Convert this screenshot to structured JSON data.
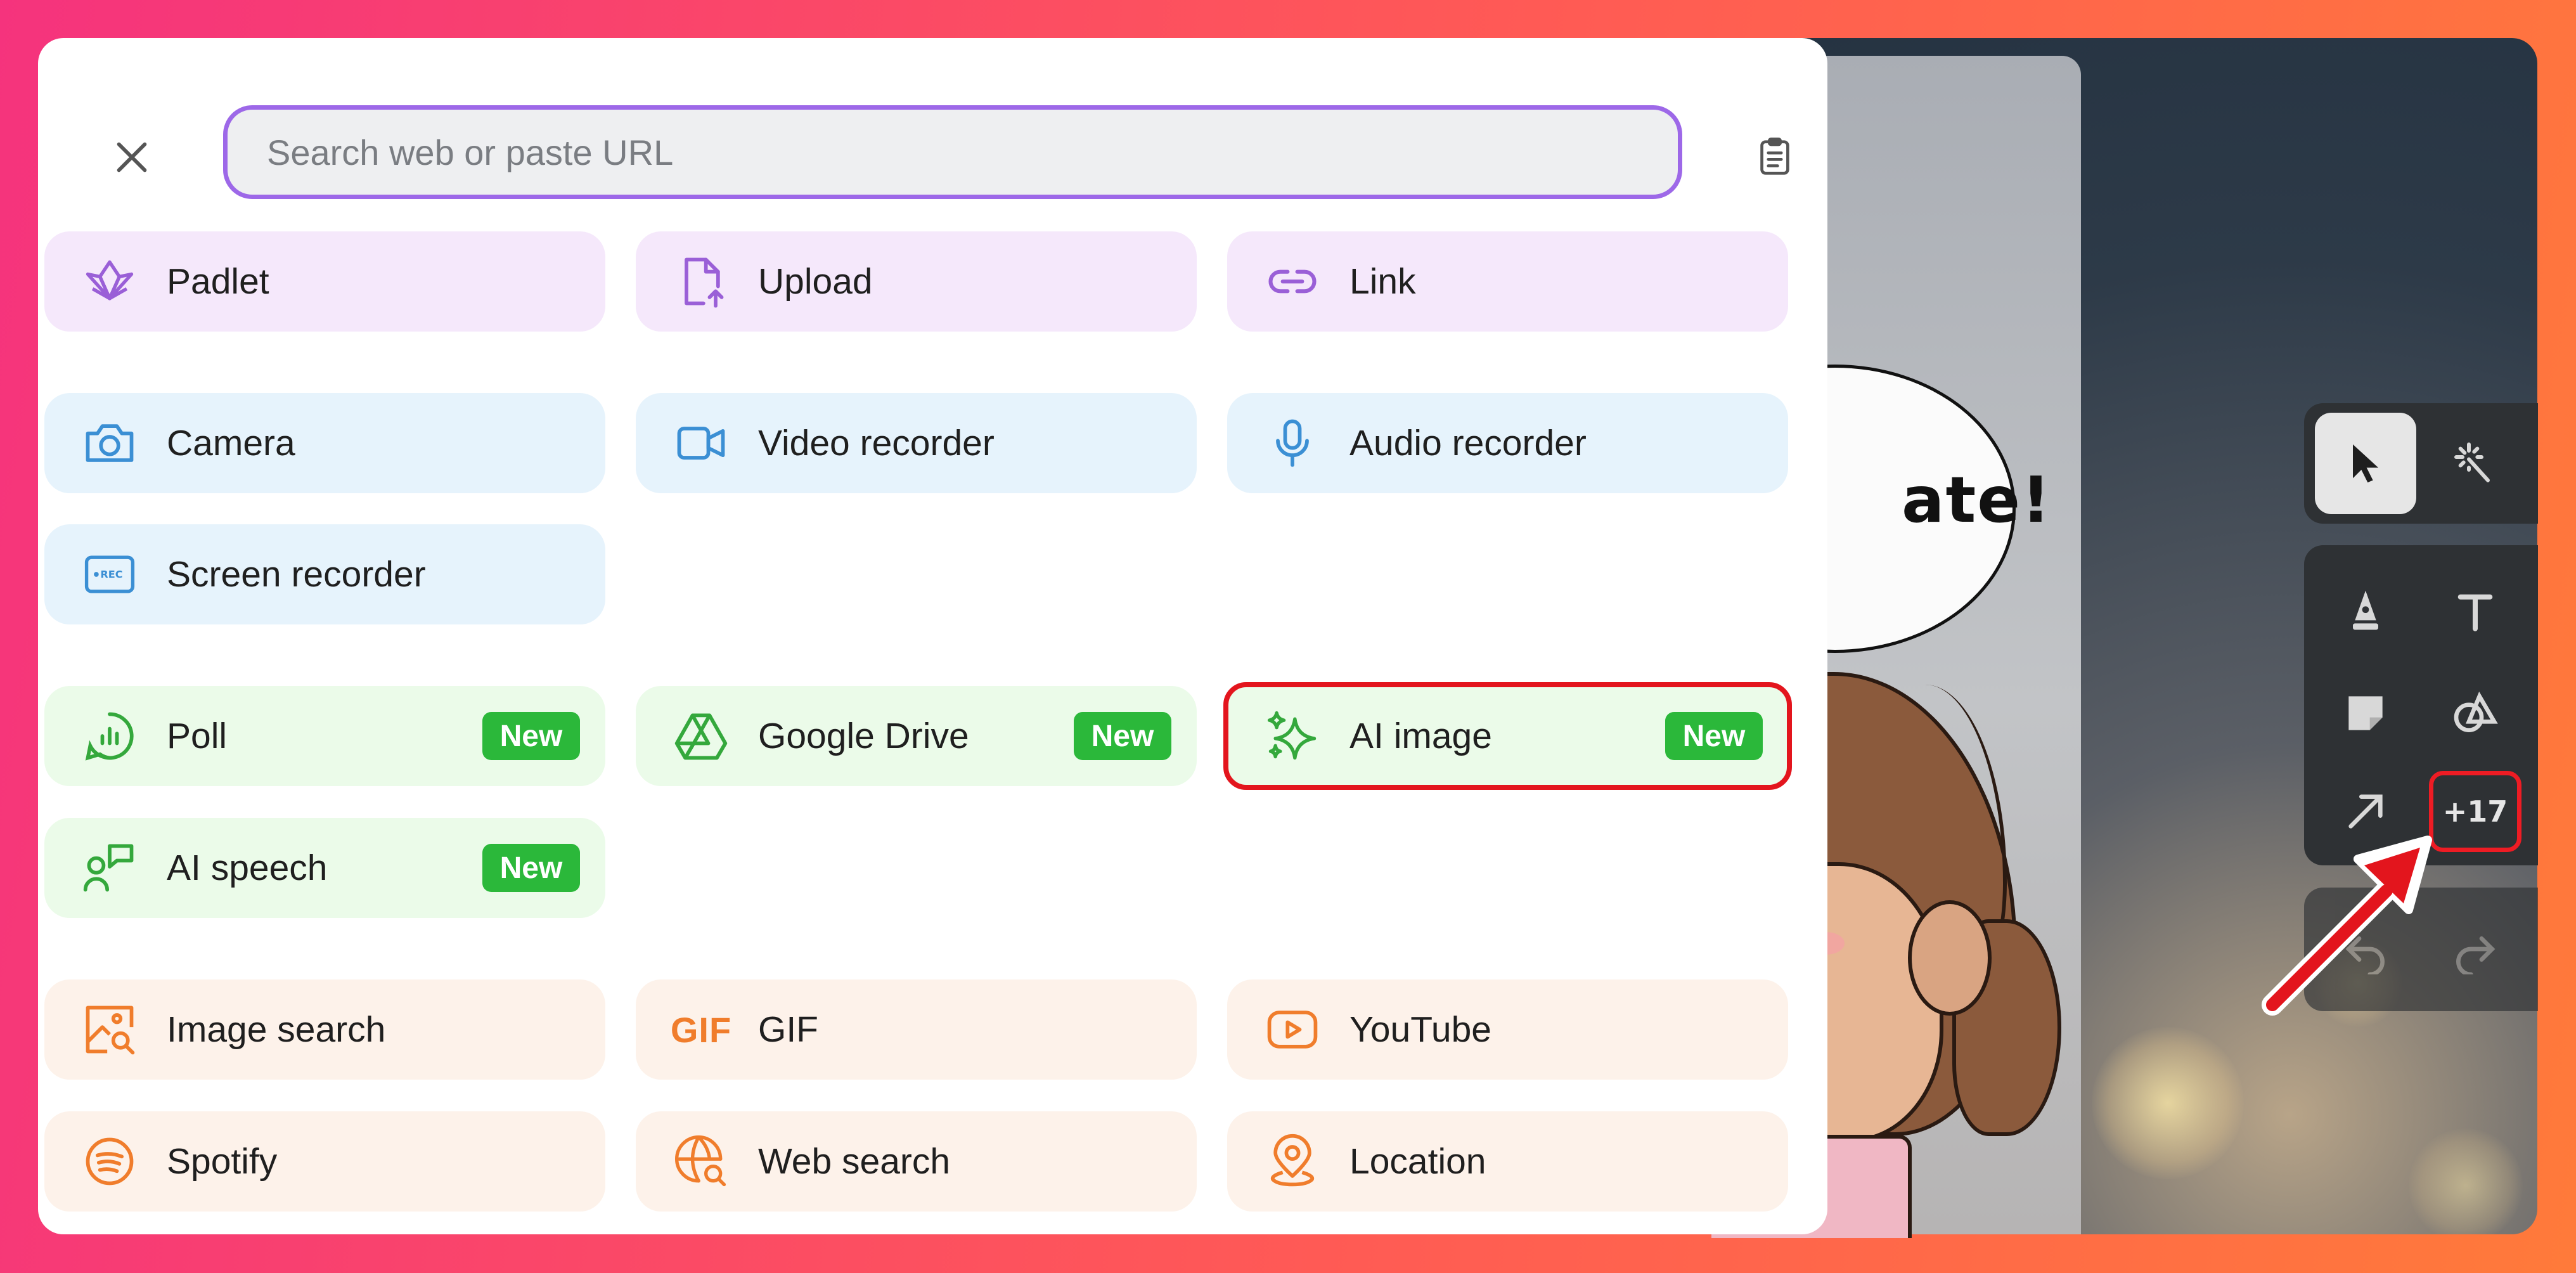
{
  "search": {
    "placeholder": "Search web or paste URL"
  },
  "badge_label": "New",
  "tiles": {
    "padlet": "Padlet",
    "upload": "Upload",
    "link": "Link",
    "camera": "Camera",
    "video_recorder": "Video recorder",
    "audio_recorder": "Audio recorder",
    "screen_recorder": "Screen recorder",
    "poll": "Poll",
    "google_drive": "Google Drive",
    "ai_image": "AI image",
    "ai_speech": "AI speech",
    "image_search": "Image search",
    "gif": "GIF",
    "gif_icon_text": "GIF",
    "youtube": "YouTube",
    "spotify": "Spotify",
    "web_search": "Web search",
    "location": "Location"
  },
  "icons": {
    "close": "close-icon",
    "paste": "clipboard-icon",
    "padlet": "padlet-logo-icon",
    "upload": "file-upload-icon",
    "link": "link-icon",
    "camera": "camera-icon",
    "video_recorder": "video-camera-icon",
    "audio_recorder": "microphone-icon",
    "screen_recorder": "rec-screen-icon",
    "poll": "poll-icon",
    "google_drive": "google-drive-icon",
    "ai_image": "sparkles-icon",
    "ai_speech": "speech-person-icon",
    "image_search": "image-search-icon",
    "youtube": "youtube-icon",
    "spotify": "spotify-icon",
    "web_search": "globe-search-icon",
    "location": "location-pin-icon"
  },
  "toolbar": {
    "more_count": "+17"
  },
  "canvas": {
    "bubble_text": "ate!"
  },
  "colors": {
    "accent_purple": "#9d68e8",
    "badge_green": "#2bb83a",
    "highlight_red": "#e3151d",
    "icon_purple": "#9a5fd7",
    "icon_blue": "#3b8fd4",
    "icon_green": "#34a83c",
    "icon_orange": "#f07d2c"
  }
}
